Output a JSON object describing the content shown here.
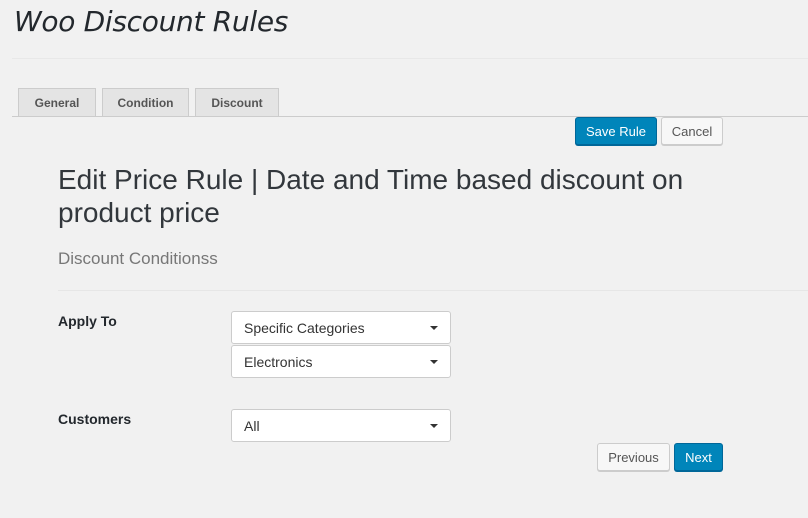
{
  "header": {
    "title": "Woo Discount Rules"
  },
  "tabs": [
    {
      "label": "General"
    },
    {
      "label": "Condition"
    },
    {
      "label": "Discount"
    }
  ],
  "toolbar": {
    "save_label": "Save Rule",
    "cancel_label": "Cancel"
  },
  "main": {
    "heading": "Edit Price Rule | Date and Time based discount on product price",
    "subheading": "Discount Conditionss"
  },
  "form": {
    "apply_to": {
      "label": "Apply To",
      "value": "Specific Categories",
      "category_value": "Electronics"
    },
    "customers": {
      "label": "Customers",
      "value": "All"
    }
  },
  "footer": {
    "previous_label": "Previous",
    "next_label": "Next"
  },
  "colors": {
    "primary": "#0085ba",
    "background": "#f1f1f1"
  }
}
